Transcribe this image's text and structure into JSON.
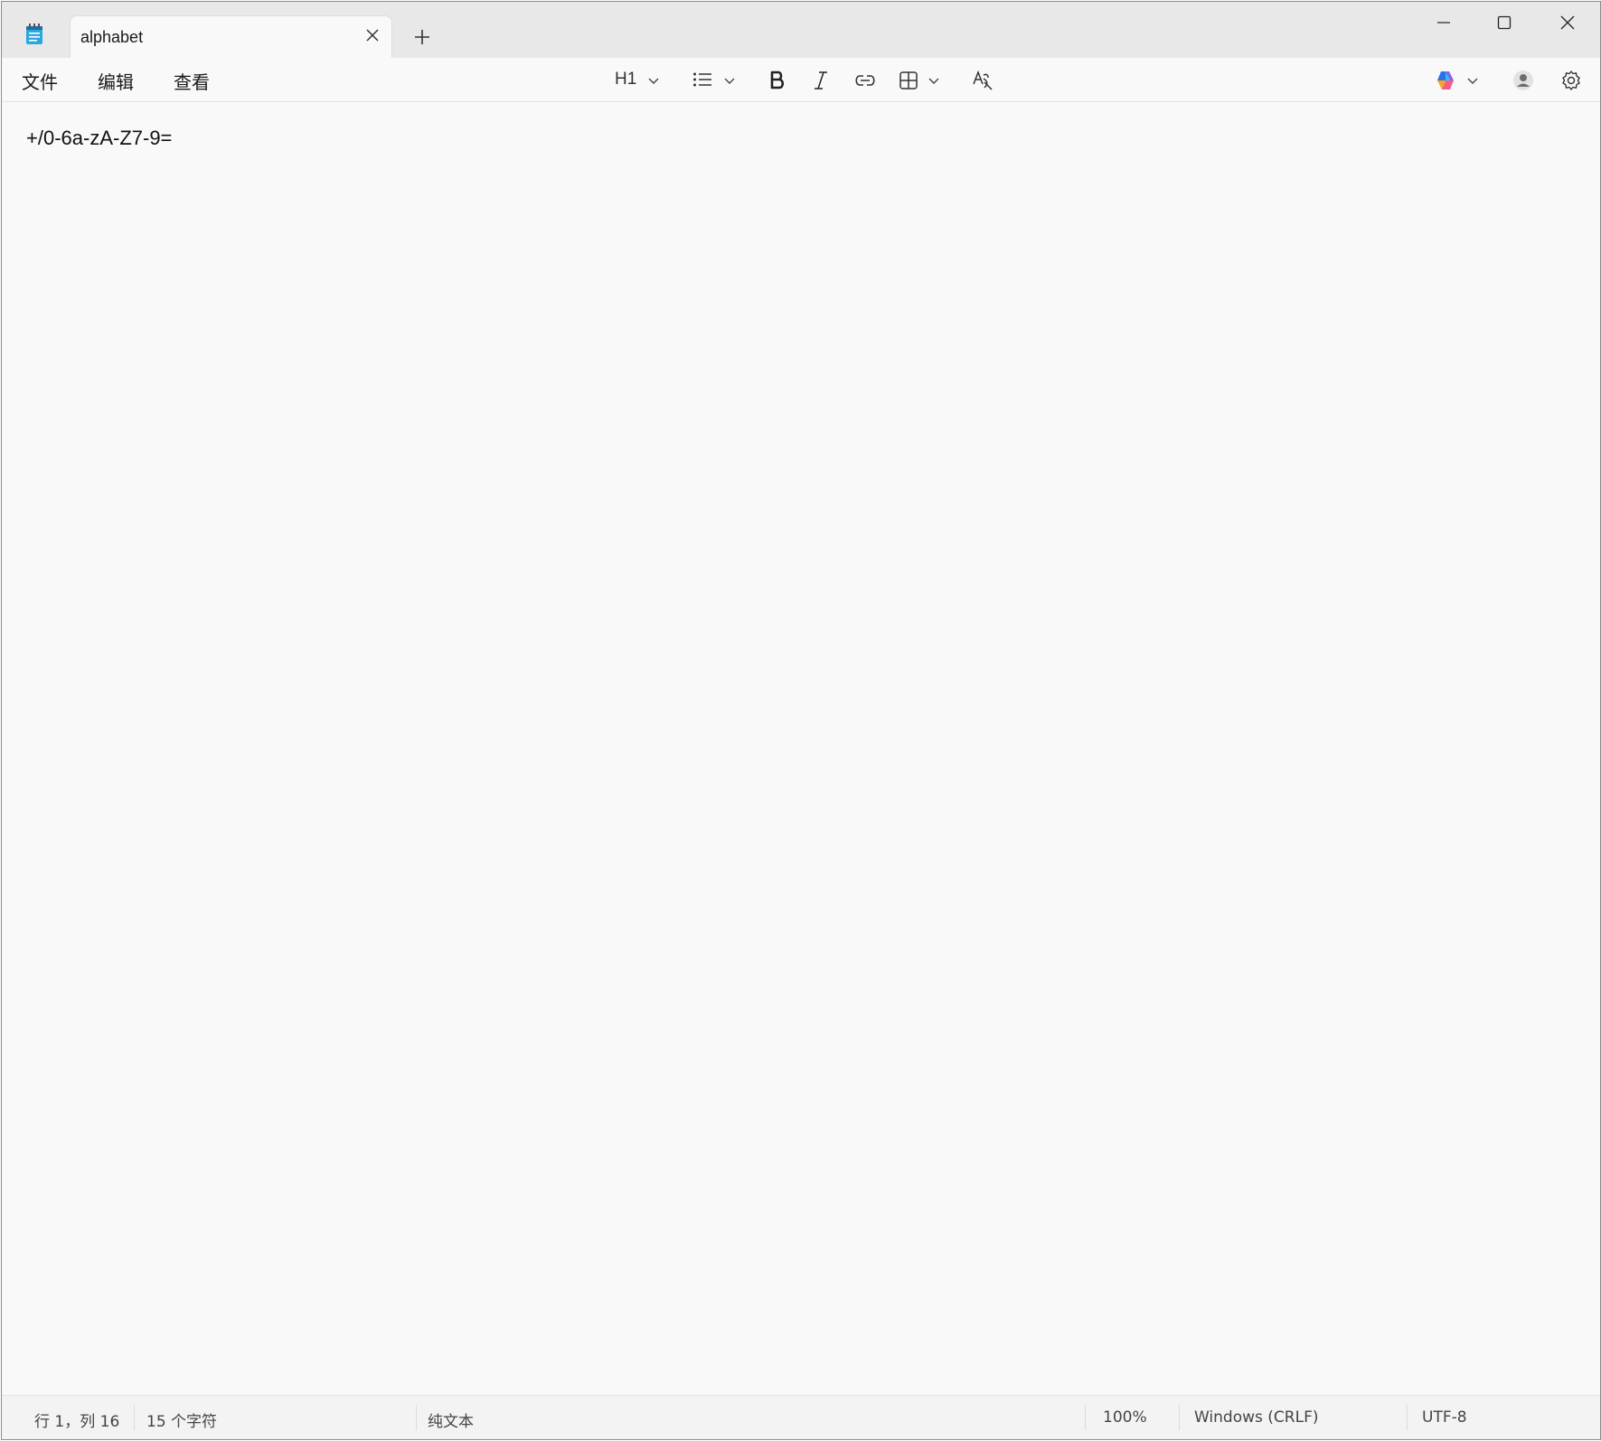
{
  "app": {
    "icon": "notepad-icon"
  },
  "tab": {
    "title": "alphabet",
    "close_icon": "close-icon",
    "new_tab_icon": "plus-icon"
  },
  "window_controls": {
    "minimize_icon": "minimize-icon",
    "maximize_icon": "maximize-icon",
    "close_icon": "close-icon"
  },
  "menu": {
    "file": "文件",
    "edit": "编辑",
    "view": "查看"
  },
  "toolbar": {
    "heading_label": "H1",
    "heading_icon": "chevron-down-icon",
    "list_icon": "bulleted-list-icon",
    "bold_icon": "bold-icon",
    "italic_icon": "italic-icon",
    "link_icon": "link-icon",
    "table_icon": "table-icon",
    "clear_format_icon": "clear-formatting-icon",
    "copilot_icon": "copilot-icon",
    "account_icon": "account-icon",
    "settings_icon": "gear-icon"
  },
  "editor": {
    "content": "+/0-6a-zA-Z7-9="
  },
  "status": {
    "position": "行 1，列 16",
    "char_count": "15 个字符",
    "format": "纯文本",
    "zoom": "100%",
    "line_ending": "Windows (CRLF)",
    "encoding": "UTF-8"
  }
}
